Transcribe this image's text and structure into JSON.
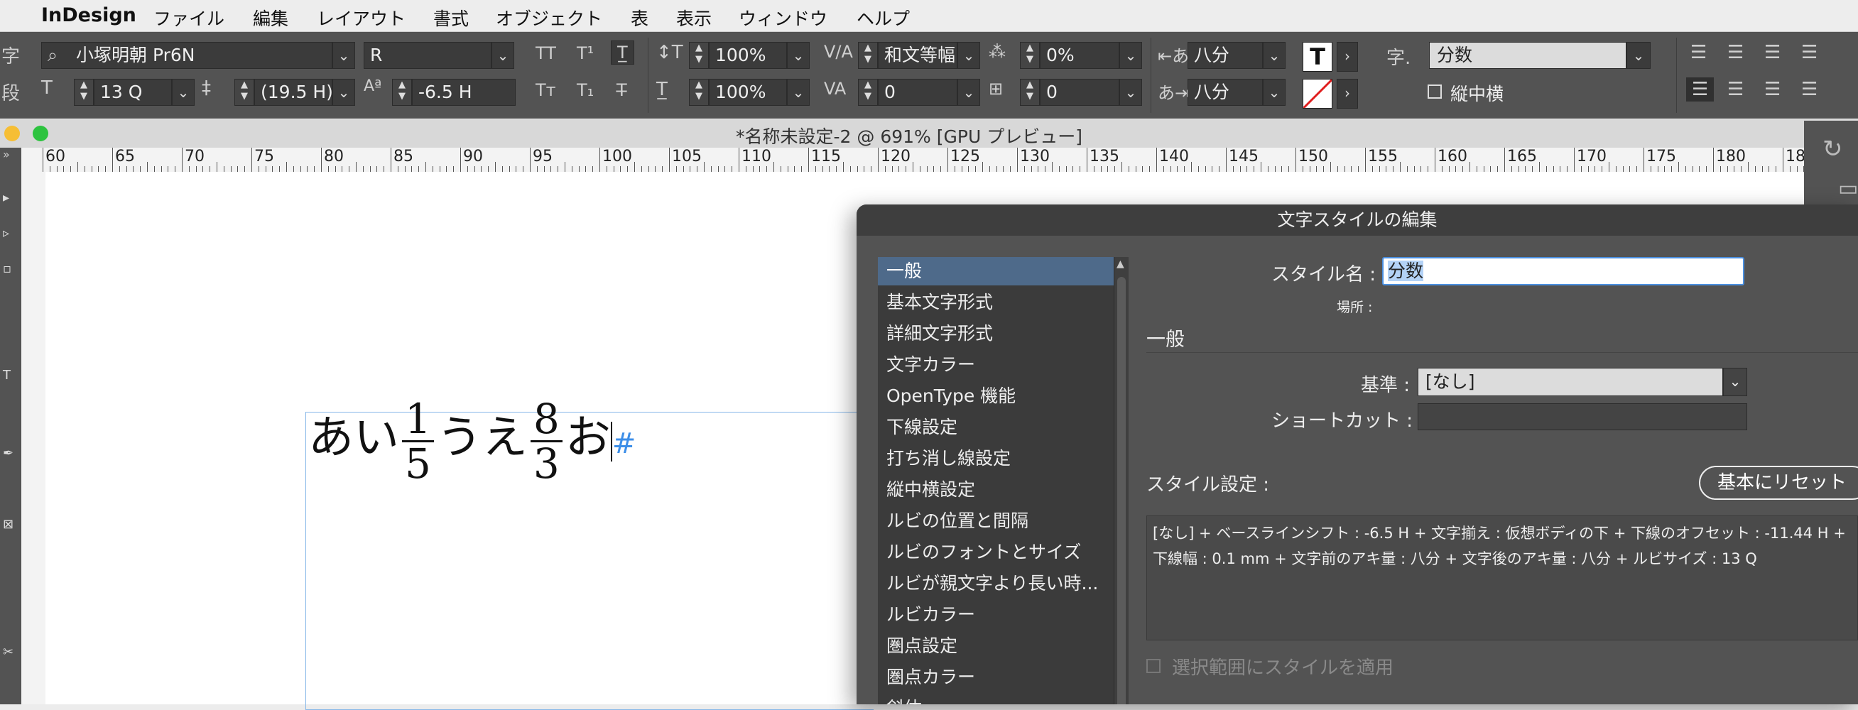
{
  "menubar": {
    "apple": "",
    "app_name": "InDesign",
    "items": [
      "ファイル",
      "編集",
      "レイアウト",
      "書式",
      "オブジェクト",
      "表",
      "表示",
      "ウィンドウ",
      "ヘルプ"
    ]
  },
  "control_panel": {
    "mode_char": "字",
    "mode_para": "段",
    "font_family": "小塚明朝 Pr6N",
    "font_style": "R",
    "font_size": "13 Q",
    "leading": "(19.5 H)",
    "baseline_shift": "-6.5 H",
    "vertical_scale": "100%",
    "horizontal_scale": "100%",
    "kerning": "和文等幅",
    "tracking": "0",
    "tsume": "0%",
    "tsume2": "0",
    "aki_before": "八分",
    "aki_after": "八分",
    "style_label": "字.",
    "char_style": "分数",
    "tatechuyoko_label": "縦中横"
  },
  "document": {
    "title": "*名称未設定-2 @ 691% [GPU プレビュー]",
    "text_before": "あい",
    "frac1_num": "1",
    "frac1_den": "5",
    "text_mid": "うえ",
    "frac2_num": "8",
    "frac2_den": "3",
    "text_after": "お",
    "end_marker": "#",
    "ruler_labels": [
      "60",
      "65",
      "70",
      "75",
      "80",
      "85",
      "90",
      "95",
      "100",
      "105",
      "110",
      "115",
      "120",
      "125",
      "130",
      "135",
      "140",
      "145",
      "150",
      "155",
      "160",
      "165",
      "170",
      "175",
      "180",
      "18"
    ]
  },
  "dialog": {
    "title": "文字スタイルの編集",
    "categories": [
      "一般",
      "基本文字形式",
      "詳細文字形式",
      "文字カラー",
      "OpenType 機能",
      "下線設定",
      "打ち消し線設定",
      "縦中横設定",
      "ルビの位置と間隔",
      "ルビのフォントとサイズ",
      "ルビが親文字より長い時...",
      "ルビカラー",
      "圏点設定",
      "圏点カラー",
      "斜体"
    ],
    "style_name_label": "スタイル名 :",
    "style_name_value": "分数",
    "location_label": "場所 :",
    "section_heading": "一般",
    "based_on_label": "基準 :",
    "based_on_value": "[なし]",
    "shortcut_label": "ショートカット :",
    "shortcut_value": "",
    "style_settings_label": "スタイル設定 :",
    "reset_button": "基本にリセット",
    "description": "[なし] + ベースラインシフト : -6.5 H + 文字揃え : 仮想ボディの下 + 下線のオフセット : -11.44 H + 下線幅 : 0.1 mm + 文字前のアキ量 : 八分 + 文字後のアキ量 : 八分 + ルビサイズ : 13 Q",
    "apply_to_selection": "選択範囲にスタイルを適用"
  }
}
